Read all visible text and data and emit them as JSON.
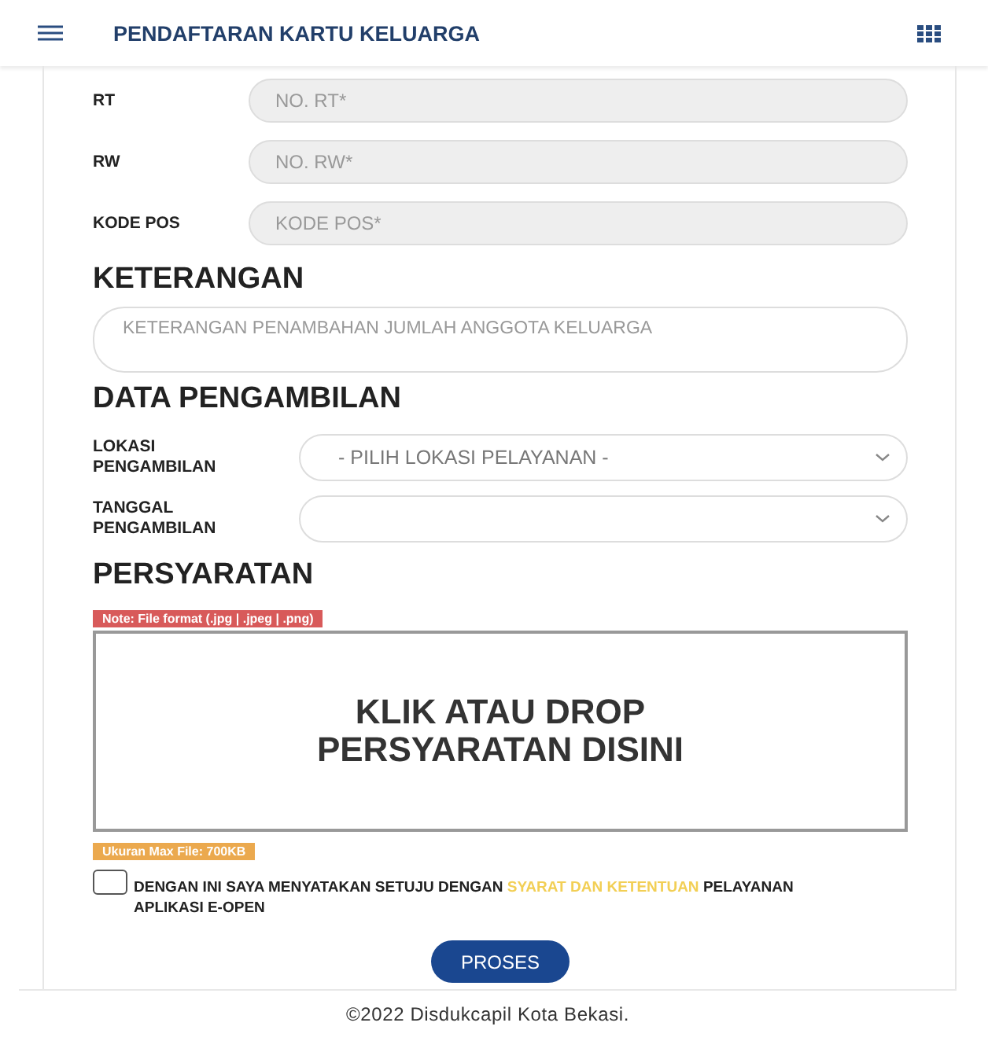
{
  "header": {
    "title": "PENDAFTARAN KARTU KELUARGA"
  },
  "address_fields": [
    {
      "label": "RT",
      "placeholder": "NO. RT*"
    },
    {
      "label": "RW",
      "placeholder": "NO. RW*"
    },
    {
      "label": "KODE POS",
      "placeholder": "KODE POS*"
    }
  ],
  "keterangan": {
    "heading": "KETERANGAN",
    "placeholder": "KETERANGAN PENAMBAHAN JUMLAH ANGGOTA KELUARGA"
  },
  "pengambilan": {
    "heading": "DATA PENGAMBILAN",
    "fields": [
      {
        "label": "LOKASI PENGAMBILAN",
        "value": "- PILIH LOKASI PELAYANAN -"
      },
      {
        "label": "TANGGAL PENGAMBILAN"
      }
    ]
  },
  "persyaratan": {
    "heading": "PERSYARATAN",
    "note": "Note: File format (.jpg | .jpeg | .png)",
    "dropzone": "KLIK ATAU DROP PERSYARATAN DISINI",
    "size_note": "Ukuran Max File: 700KB"
  },
  "agreement": {
    "checked": false,
    "text_before": "DENGAN INI SAYA MENYATAKAN SETUJU DENGAN",
    "link": "SYARAT DAN KETENTUAN",
    "text_after": "PELAYANAN APLIKASI E-OPEN"
  },
  "submit": "PROSES",
  "footer": "©2022 Disdukcapil Kota Bekasi."
}
